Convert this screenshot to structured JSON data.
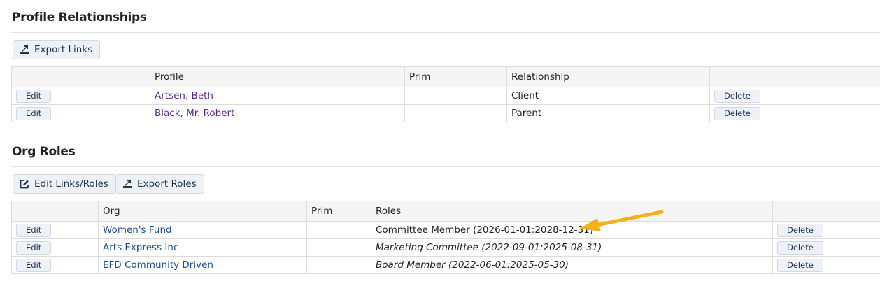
{
  "profile_relationships": {
    "title": "Profile Relationships",
    "export_button": "Export Links",
    "columns": [
      "",
      "Profile",
      "Prim",
      "Relationship",
      ""
    ],
    "rows": [
      {
        "edit": "Edit",
        "profile": "Artsen, Beth",
        "prim": "",
        "relationship": "Client",
        "delete": "Delete"
      },
      {
        "edit": "Edit",
        "profile": "Black, Mr. Robert",
        "prim": "",
        "relationship": "Parent",
        "delete": "Delete"
      }
    ]
  },
  "org_roles": {
    "title": "Org Roles",
    "edit_links_button": "Edit Links/Roles",
    "export_button": "Export Roles",
    "columns": [
      "",
      "Org",
      "Prim",
      "Roles",
      ""
    ],
    "rows": [
      {
        "edit": "Edit",
        "org": "Women's Fund",
        "prim": "",
        "roles": "Committee Member (2026-01-01:2028-12-31)",
        "italic": false,
        "delete": "Delete"
      },
      {
        "edit": "Edit",
        "org": "Arts Express Inc",
        "prim": "",
        "roles": "Marketing Committee (2022-09-01:2025-08-31)",
        "italic": true,
        "delete": "Delete"
      },
      {
        "edit": "Edit",
        "org": "EFD Community Driven",
        "prim": "",
        "roles": "Board Member (2022-06-01:2025-05-30)",
        "italic": true,
        "delete": "Delete"
      }
    ]
  },
  "colors": {
    "profile_link": "#5b2a86",
    "org_link": "#1f4f8f",
    "annotation_arrow": "#f5b01a"
  },
  "icons": {
    "export": "export-icon",
    "edit_links": "edit-square-icon",
    "annotation": "arrow-annotation"
  }
}
